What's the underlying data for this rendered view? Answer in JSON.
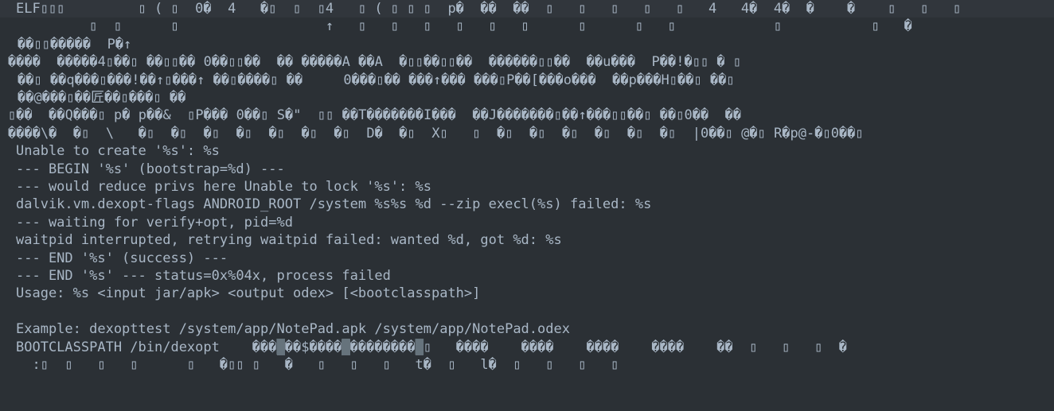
{
  "editor": {
    "lines": [
      "ELF▯▯▯         ▯ ( ▯  0�  4   �▯  ▯  ▯4   ▯ ( ▯ ▯ ▯  p�  ��  ��  ▯   ▯   ▯   ▯   ▯   4   4�  4�  �    �    ▯   ▯   ▯",
      "         ▯  ▯      ▯                  ↑   ▯   ▯   ▯   ▯   ▯   ▯      ▯      ▯   ▯            ▯           ▯   �",
      "��▯▯�����  P�↑",
      "����  �����4▯��▯ ��▯▯�� 0��▯▯��  �� �����A ��A  �▯▯��▯▯��  ������▯▯��  ��u���  P��!�▯▯ � ▯",
      "��▯ ��q���▯���!��↑▯���↑ ��▯����▯ ��     0���▯�� ���↑��� ���▯P��[���o���  ��p���H▯��▯ ��▯",
      "��@���▯��匠��▯���▯ ��",
      "▯��  ��Q���▯ p� p��&  ▯P��� 0��▯ S�\"  ▯▯ ��T�������I���  ��J�������▯��↑���▯▯��▯ ��▯0��  ��",
      "����\\�  �▯  \\   �▯  �▯  �▯  �▯  �▯  �▯  �▯  D�  �▯  X▯   ▯  �▯  �▯  �▯  �▯  �▯  �▯  |0��▯ @�▯ R�p@-�▯0��▯",
      "Unable to create '%s': %s",
      "--- BEGIN '%s' (bootstrap=%d) ---",
      "--- would reduce privs here Unable to lock '%s': %s",
      "dalvik.vm.dexopt-flags ANDROID_ROOT /system %s%s %d --zip execl(%s) failed: %s",
      "--- waiting for verify+opt, pid=%d",
      "waitpid interrupted, retrying waitpid failed: wanted %d, got %d: %s",
      "--- END '%s' (success) ---",
      "--- END '%s' --- status=0x%04x, process failed",
      "Usage: %s <input jar/apk> <output odex> [<bootclasspath>]",
      "",
      "Example: dexopttest /system/app/NotePad.apk /system/app/NotePad.odex",
      "",
      "  :▯  ▯   ▯   ▯      ▯   �▯▯ ▯   �   ▯   ▯   ▯   t�  ▯   l�  ▯   ▯   ▯   ▯"
    ],
    "bootclasspath_line": {
      "prefix": "BOOTCLASSPATH /bin/dexopt    ���",
      "seg1": "��$����",
      "seg2": "��������",
      "suffix": "▯   ����    ����    ����    ����    ��  ▯   ▯   ▯  �"
    },
    "colors": {
      "background": "#2b3035",
      "text": "#a9b7c6",
      "current_line": "#31363c"
    }
  }
}
